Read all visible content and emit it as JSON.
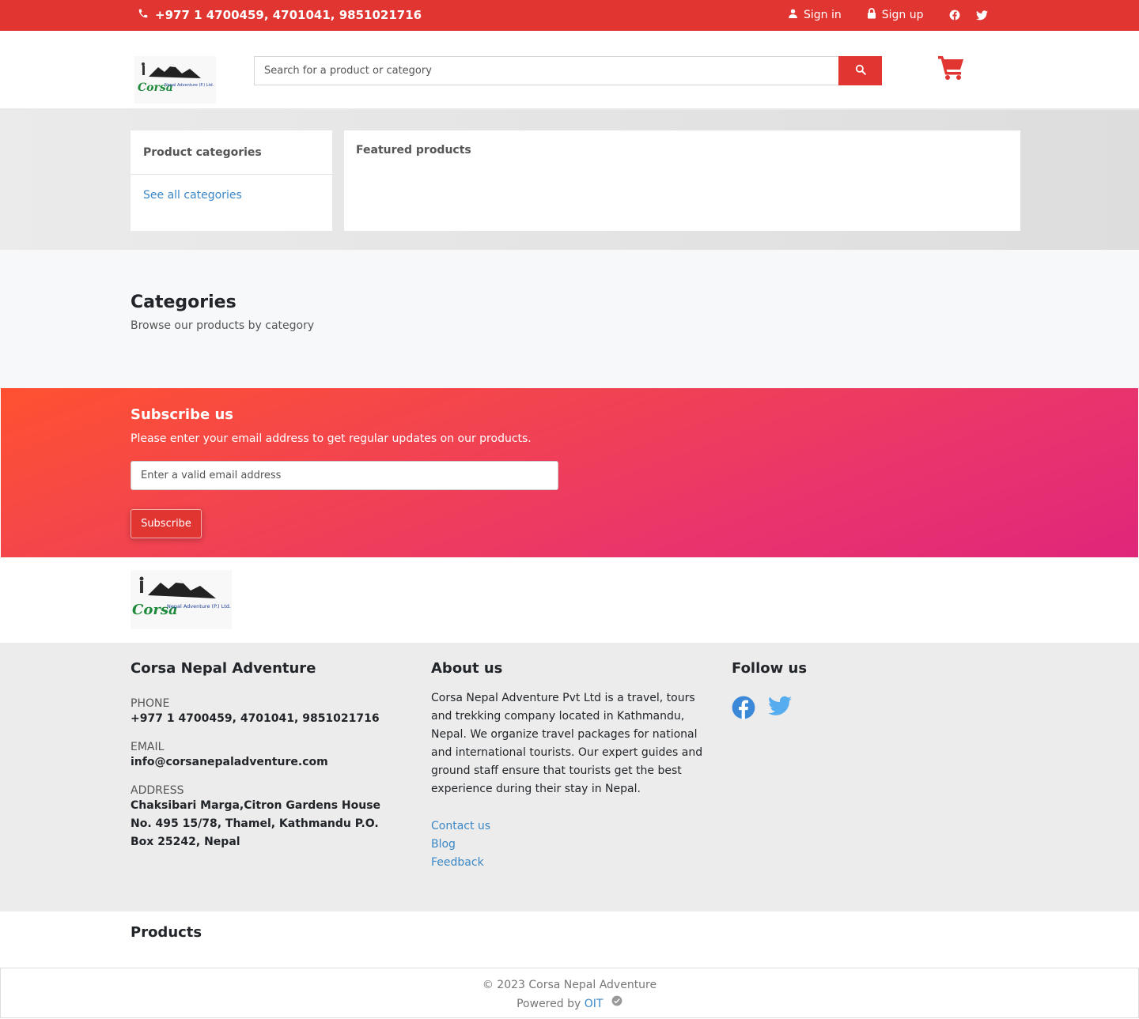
{
  "topbar": {
    "phone": "+977 1 4700459, 4701041, 9851021716",
    "signin": "Sign in",
    "signup": "Sign up"
  },
  "header": {
    "logo_text": "Corsa",
    "logo_subtext": "Nepal Adventure (P.) Ltd.",
    "search_placeholder": "Search for a product or category"
  },
  "hero": {
    "categories_title": "Product categories",
    "see_all": "See all categories",
    "featured_title": "Featured products"
  },
  "categories": {
    "title": "Categories",
    "subtitle": "Browse our products by category"
  },
  "subscribe": {
    "title": "Subscribe us",
    "text": "Please enter your email address to get regular updates on our products.",
    "placeholder": "Enter a valid email address",
    "button": "Subscribe"
  },
  "footer": {
    "company": "Corsa Nepal Adventure",
    "phone_label": "PHONE",
    "phone": "+977 1 4700459, 4701041, 9851021716",
    "email_label": "EMAIL",
    "email": "info@corsanepaladventure.com",
    "address_label": "ADDRESS",
    "address": "Chaksibari Marga,Citron Gardens House No. 495 15/78, Thamel, Kathmandu P.O. Box 25242, Nepal",
    "about_title": "About us",
    "about_text": "Corsa Nepal Adventure Pvt Ltd is a travel, tours and trekking company located in Kathmandu, Nepal. We organize travel packages for national and international tourists. Our expert guides and ground staff ensure that tourists get the best experience during their stay in Nepal.",
    "links": [
      "Contact us",
      "Blog",
      "Feedback"
    ],
    "follow_title": "Follow us"
  },
  "products": {
    "title": "Products"
  },
  "copyright": {
    "text": "© 2023 Corsa Nepal Adventure",
    "powered": "Powered by",
    "powered_link": "OIT"
  },
  "colors": {
    "brand": "#e03531",
    "link": "#3b87c6",
    "facebook": "#1877f2",
    "twitter": "#55acee"
  },
  "icons": [
    "phone-icon",
    "user-icon",
    "lock-icon",
    "facebook-icon",
    "twitter-icon",
    "search-icon",
    "cart-icon",
    "check-circle-icon"
  ]
}
